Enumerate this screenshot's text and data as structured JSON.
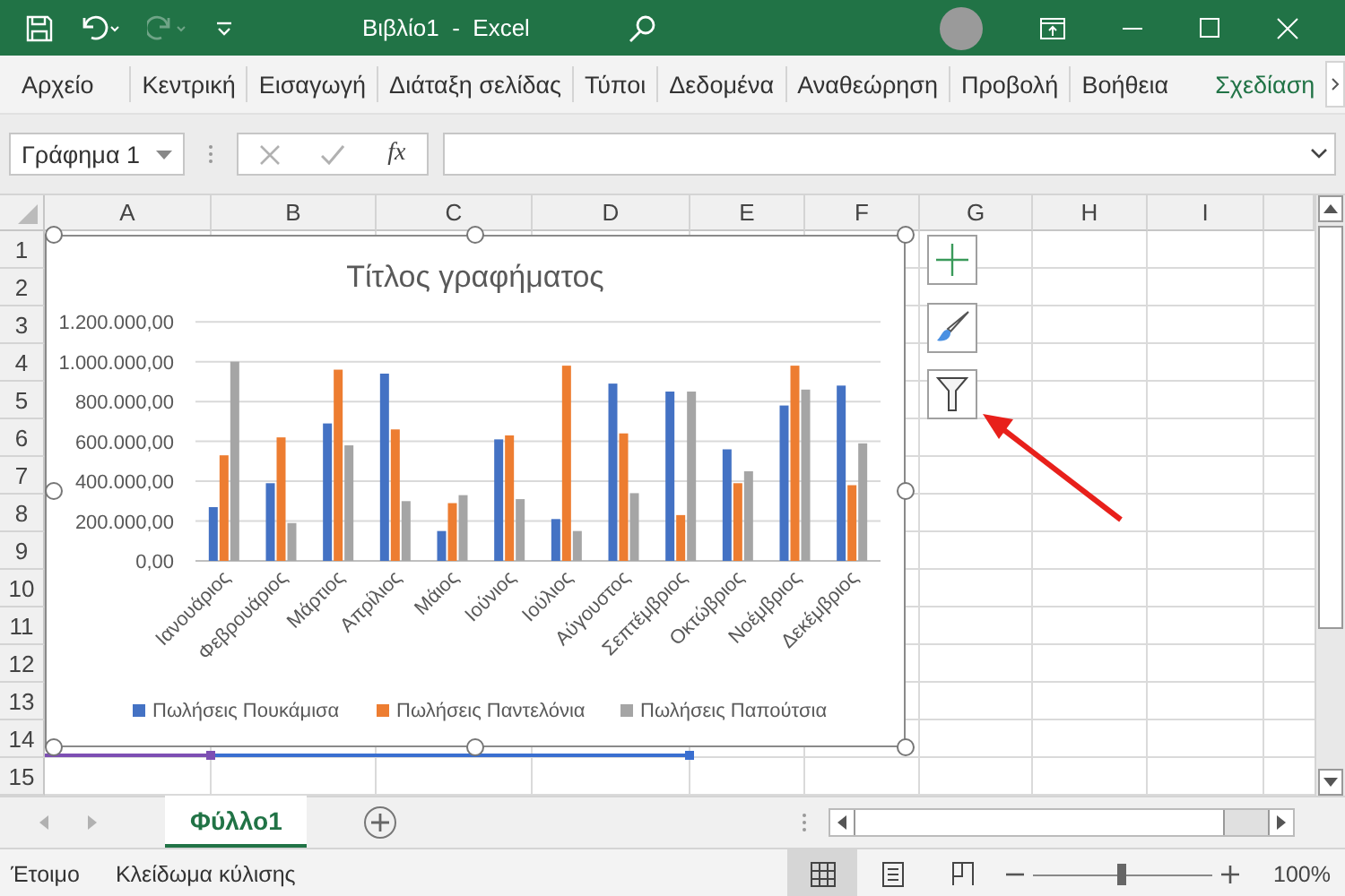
{
  "title_bar": {
    "title": "Βιβλίο1  -  Excel",
    "quick_access": [
      {
        "kind": "save",
        "disabled": false
      },
      {
        "kind": "undo",
        "disabled": false
      },
      {
        "kind": "redo",
        "disabled": true
      },
      {
        "kind": "customize",
        "disabled": false
      }
    ]
  },
  "ribbon_tabs": [
    {
      "label": "Αρχείο",
      "selected": false,
      "kind": "standard"
    },
    {
      "label": "Κεντρική",
      "selected": false,
      "kind": "standard"
    },
    {
      "label": "Εισαγωγή",
      "selected": false,
      "kind": "standard"
    },
    {
      "label": "Διάταξη σελίδας",
      "selected": false,
      "kind": "standard"
    },
    {
      "label": "Τύποι",
      "selected": false,
      "kind": "standard"
    },
    {
      "label": "Δεδομένα",
      "selected": false,
      "kind": "standard"
    },
    {
      "label": "Αναθεώρηση",
      "selected": false,
      "kind": "standard"
    },
    {
      "label": "Προβολή",
      "selected": false,
      "kind": "standard"
    },
    {
      "label": "Βοήθεια",
      "selected": false,
      "kind": "standard"
    },
    {
      "label": "Σχεδίαση",
      "selected": false,
      "kind": "contextual"
    }
  ],
  "formula_bar": {
    "name_box": "Γράφημα 1",
    "function_label": "fx",
    "cancel_disabled": true,
    "enter_disabled": true
  },
  "columns": [
    "A",
    "B",
    "C",
    "D",
    "E",
    "F",
    "G",
    "H",
    "I"
  ],
  "rows": [
    "1",
    "2",
    "3",
    "4",
    "5",
    "6",
    "7",
    "8",
    "9",
    "10",
    "11",
    "12",
    "13",
    "14",
    "15"
  ],
  "chart": {
    "chart_data": {
      "type": "bar",
      "title": "Τίτλος γραφήματος",
      "categories": [
        "Ιανουάριος",
        "Φεβρουάριος",
        "Μάρτιος",
        "Απρίλιος",
        "Μάιος",
        "Ιούνιος",
        "Ιούλιος",
        "Αύγουστος",
        "Σεπτέμβριος",
        "Οκτώβριος",
        "Νοέμβριος",
        "Δεκέμβριος"
      ],
      "series": [
        {
          "name": "Πωλήσεις Πουκάμισα",
          "color": "#4472c4",
          "values": [
            270000,
            390000,
            690000,
            940000,
            150000,
            610000,
            210000,
            890000,
            850000,
            560000,
            780000,
            880000
          ]
        },
        {
          "name": "Πωλήσεις Παντελόνια",
          "color": "#ed7d31",
          "values": [
            530000,
            620000,
            960000,
            660000,
            290000,
            630000,
            980000,
            640000,
            230000,
            390000,
            980000,
            380000
          ]
        },
        {
          "name": "Πωλήσεις Παπούτσια",
          "color": "#a5a5a5",
          "values": [
            1000000,
            190000,
            580000,
            300000,
            330000,
            310000,
            150000,
            340000,
            850000,
            450000,
            860000,
            590000
          ]
        }
      ],
      "ylim": [
        0,
        1200000
      ],
      "yticks": [
        {
          "value": 0,
          "label": "0,00"
        },
        {
          "value": 200000,
          "label": "200.000,00"
        },
        {
          "value": 400000,
          "label": "400.000,00"
        },
        {
          "value": 600000,
          "label": "600.000,00"
        },
        {
          "value": 800000,
          "label": "800.000,00"
        },
        {
          "value": 1000000,
          "label": "1.000.000,00"
        },
        {
          "value": 1200000,
          "label": "1.200.000,00"
        }
      ],
      "grid": true,
      "legend": "bottom"
    }
  },
  "sheet_tabs": [
    {
      "label": "Φύλλο1",
      "selected": true
    }
  ],
  "status_bar": {
    "status": "Έτοιμο",
    "scroll_lock": "Κλείδωμα κύλισης",
    "views": [
      {
        "kind": "normal",
        "selected": true
      },
      {
        "kind": "page_layout",
        "selected": false
      },
      {
        "kind": "page_break",
        "selected": false
      }
    ],
    "zoom": {
      "level": 0.5,
      "reading": "100%"
    }
  }
}
